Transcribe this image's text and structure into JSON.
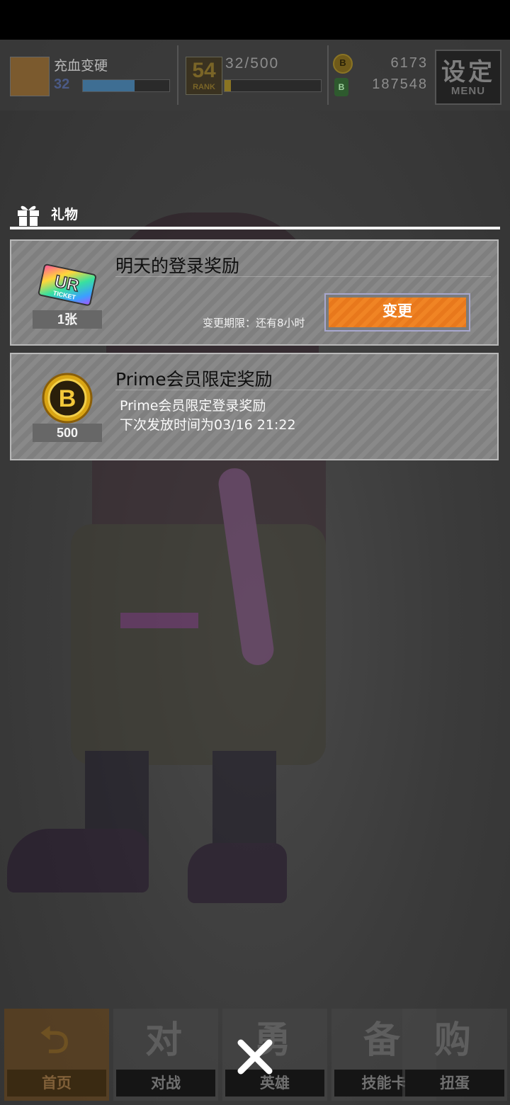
{
  "hud": {
    "player_name": "充血变硬",
    "player_level": "32",
    "exp_fraction": 0.6,
    "rank": "54",
    "rank_label": "RANK",
    "rank_progress": "32/500",
    "rank_fraction": 0.064,
    "coin_symbol": "B",
    "gem_symbol": "B",
    "coins": "6173",
    "gems": "187548",
    "menu_title": "设定",
    "menu_sub": "MENU"
  },
  "gift": {
    "title": "礼物",
    "items": [
      {
        "title": "明天的登录奖励",
        "count": "1张",
        "icon": "ur-ticket-icon",
        "icon_text": "UR",
        "icon_sub": "TICKET",
        "deadline": "变更期限：还有8小时",
        "button": "变更"
      },
      {
        "title": "Prime会员限定奖励",
        "count": "500",
        "icon": "coin-icon",
        "icon_text": "B",
        "desc_line1": "Prime会员限定登录奖励",
        "desc_line2": "下次发放时间为03/16  21:22"
      }
    ]
  },
  "nav": {
    "tabs": [
      {
        "label": "首页",
        "icon": "home-return-icon",
        "glyph": "⮌"
      },
      {
        "label": "对战",
        "icon": "gamepad-icon",
        "glyph": "对"
      },
      {
        "label": "英雄",
        "icon": "hero-icon",
        "glyph": "勇"
      },
      {
        "label": "技能卡",
        "icon": "card-icon",
        "glyph": "备"
      },
      {
        "label": "扭蛋",
        "icon": "gacha-icon",
        "glyph": "购"
      }
    ]
  },
  "colors": {
    "accent_orange": "#f08424",
    "panel_gray": "#898989"
  }
}
